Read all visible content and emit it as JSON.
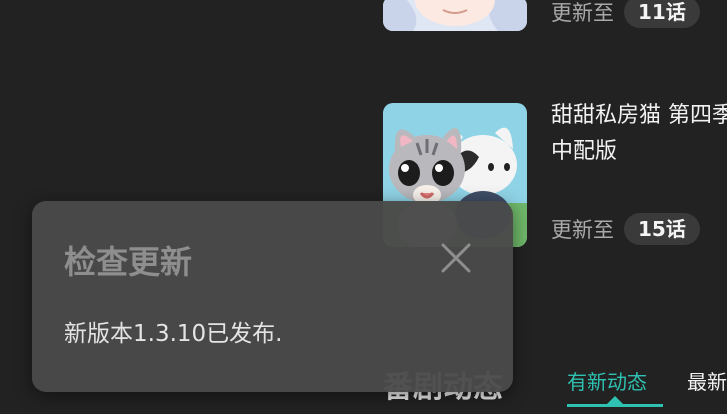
{
  "list": {
    "items": [
      {
        "title": "",
        "update_label": "更新至",
        "episode": "11话"
      },
      {
        "title": "甜甜私房猫 第四季 中配版",
        "update_label": "更新至",
        "episode": "15话"
      }
    ]
  },
  "section": {
    "title": "番剧动态",
    "tabs": [
      {
        "label": "有新动态",
        "active": true
      },
      {
        "label": "最新"
      }
    ]
  },
  "dialog": {
    "title": "检查更新",
    "message": "新版本1.3.10已发布.",
    "close_icon": "close-icon"
  },
  "colors": {
    "background": "#222222",
    "accent": "#2fc1b1",
    "dialog_bg": "#4a4a4a",
    "badge_bg": "#3a3a3a"
  }
}
